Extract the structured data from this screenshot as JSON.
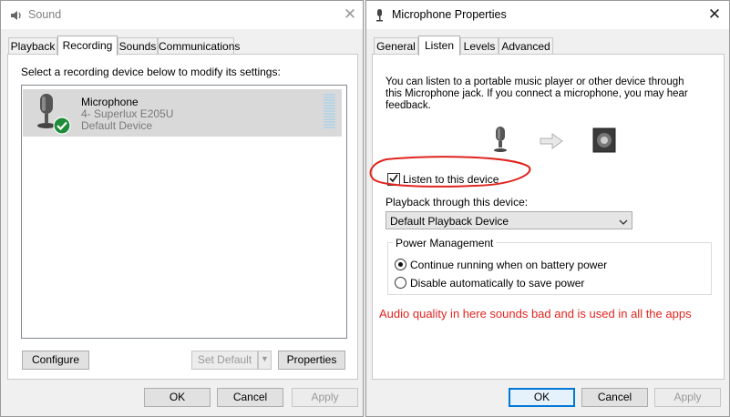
{
  "sound": {
    "title": "Sound",
    "tabs": [
      {
        "label": "Playback"
      },
      {
        "label": "Recording"
      },
      {
        "label": "Sounds"
      },
      {
        "label": "Communications"
      }
    ],
    "instruction": "Select a recording device below to modify its settings:",
    "device": {
      "name": "Microphone",
      "detail": "4- Superlux E205U",
      "status": "Default Device"
    },
    "buttons": {
      "configure": "Configure",
      "set_default": "Set Default",
      "properties": "Properties",
      "ok": "OK",
      "cancel": "Cancel",
      "apply": "Apply"
    }
  },
  "mic": {
    "title": "Microphone Properties",
    "tabs": [
      {
        "label": "General"
      },
      {
        "label": "Listen"
      },
      {
        "label": "Levels"
      },
      {
        "label": "Advanced"
      }
    ],
    "description_lines": [
      "You can listen to a portable music player or other device through",
      "this Microphone jack.  If you connect a microphone, you may hear",
      "feedback."
    ],
    "listen_checkbox": {
      "label": "Listen to this device",
      "checked": true
    },
    "playback_label": "Playback through this device:",
    "playback_select": "Default Playback Device",
    "power_group": {
      "title": "Power Management",
      "options": [
        {
          "label": "Continue running when on battery power",
          "selected": true
        },
        {
          "label": "Disable automatically to save power",
          "selected": false
        }
      ]
    },
    "annotation": "Audio quality in here sounds bad and is used in all the apps",
    "buttons": {
      "ok": "OK",
      "cancel": "Cancel",
      "apply": "Apply"
    }
  },
  "colors": {
    "annotation_red": "#e0241f",
    "check_green": "#1e8c3a",
    "focus_blue": "#0078d7"
  }
}
